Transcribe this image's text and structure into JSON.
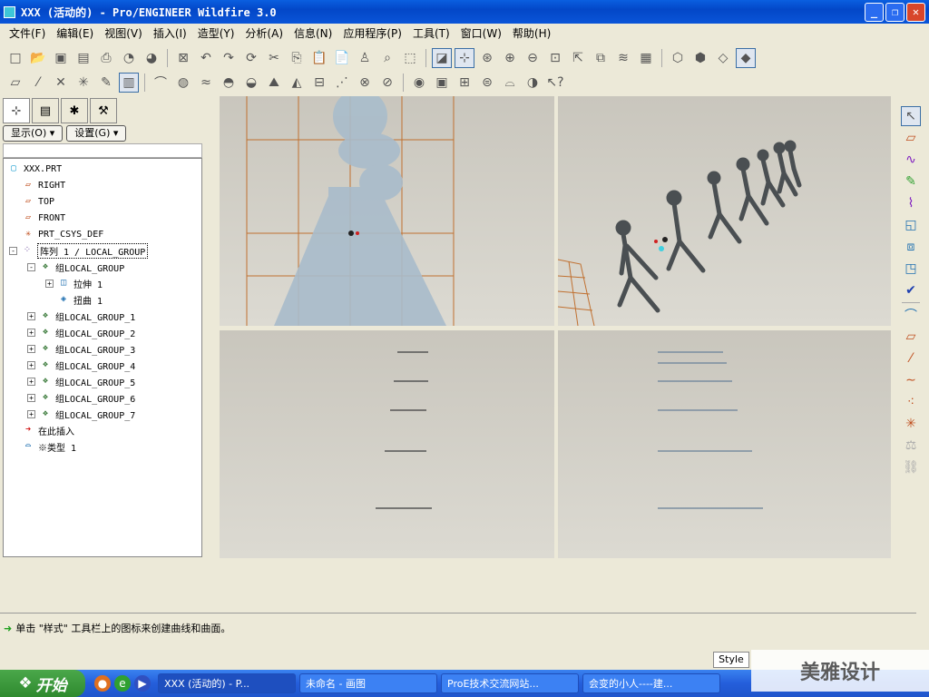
{
  "window": {
    "title": "XXX (活动的) - Pro/ENGINEER Wildfire 3.0"
  },
  "menu": [
    "文件(F)",
    "编辑(E)",
    "视图(V)",
    "插入(I)",
    "造型(Y)",
    "分析(A)",
    "信息(N)",
    "应用程序(P)",
    "工具(T)",
    "窗口(W)",
    "帮助(H)"
  ],
  "left_panel": {
    "show_label": "显示(O) ▾",
    "settings_label": "设置(G) ▾"
  },
  "tree": [
    {
      "label": "XXX.PRT",
      "icon": "part-icon",
      "indent": 0
    },
    {
      "label": "RIGHT",
      "icon": "datum-plane-icon",
      "indent": 1
    },
    {
      "label": "TOP",
      "icon": "datum-plane-icon",
      "indent": 1
    },
    {
      "label": "FRONT",
      "icon": "datum-plane-icon",
      "indent": 1
    },
    {
      "label": "PRT_CSYS_DEF",
      "icon": "csys-icon",
      "indent": 1
    },
    {
      "label": "阵列 1 / LOCAL_GROUP",
      "icon": "pattern-icon",
      "indent": 1,
      "expand": "-"
    },
    {
      "label": "组LOCAL_GROUP",
      "icon": "group-icon",
      "indent": 2,
      "expand": "-"
    },
    {
      "label": "拉伸 1",
      "icon": "extrude-icon",
      "indent": 3,
      "expand": "+"
    },
    {
      "label": "扭曲 1",
      "icon": "warp-icon",
      "indent": 3
    },
    {
      "label": "组LOCAL_GROUP_1",
      "icon": "group-icon",
      "indent": 2,
      "expand": "+"
    },
    {
      "label": "组LOCAL_GROUP_2",
      "icon": "group-icon",
      "indent": 2,
      "expand": "+"
    },
    {
      "label": "组LOCAL_GROUP_3",
      "icon": "group-icon",
      "indent": 2,
      "expand": "+"
    },
    {
      "label": "组LOCAL_GROUP_4",
      "icon": "group-icon",
      "indent": 2,
      "expand": "+"
    },
    {
      "label": "组LOCAL_GROUP_5",
      "icon": "group-icon",
      "indent": 2,
      "expand": "+"
    },
    {
      "label": "组LOCAL_GROUP_6",
      "icon": "group-icon",
      "indent": 2,
      "expand": "+"
    },
    {
      "label": "组LOCAL_GROUP_7",
      "icon": "group-icon",
      "indent": 2,
      "expand": "+"
    },
    {
      "label": "在此插入",
      "icon": "insert-arrow-icon",
      "indent": 1
    },
    {
      "label": "※类型 1",
      "icon": "style-icon",
      "indent": 1
    }
  ],
  "message": "单击 \"样式\" 工具栏上的图标来创建曲线和曲面。",
  "status": {
    "style_label": "Style"
  },
  "taskbar": {
    "start": "开始",
    "items": [
      "XXX (活动的) - P...",
      "未命名 - 画图",
      "ProE技术交流网站...",
      "会变的小人----建..."
    ]
  },
  "watermark": "美雅设计"
}
